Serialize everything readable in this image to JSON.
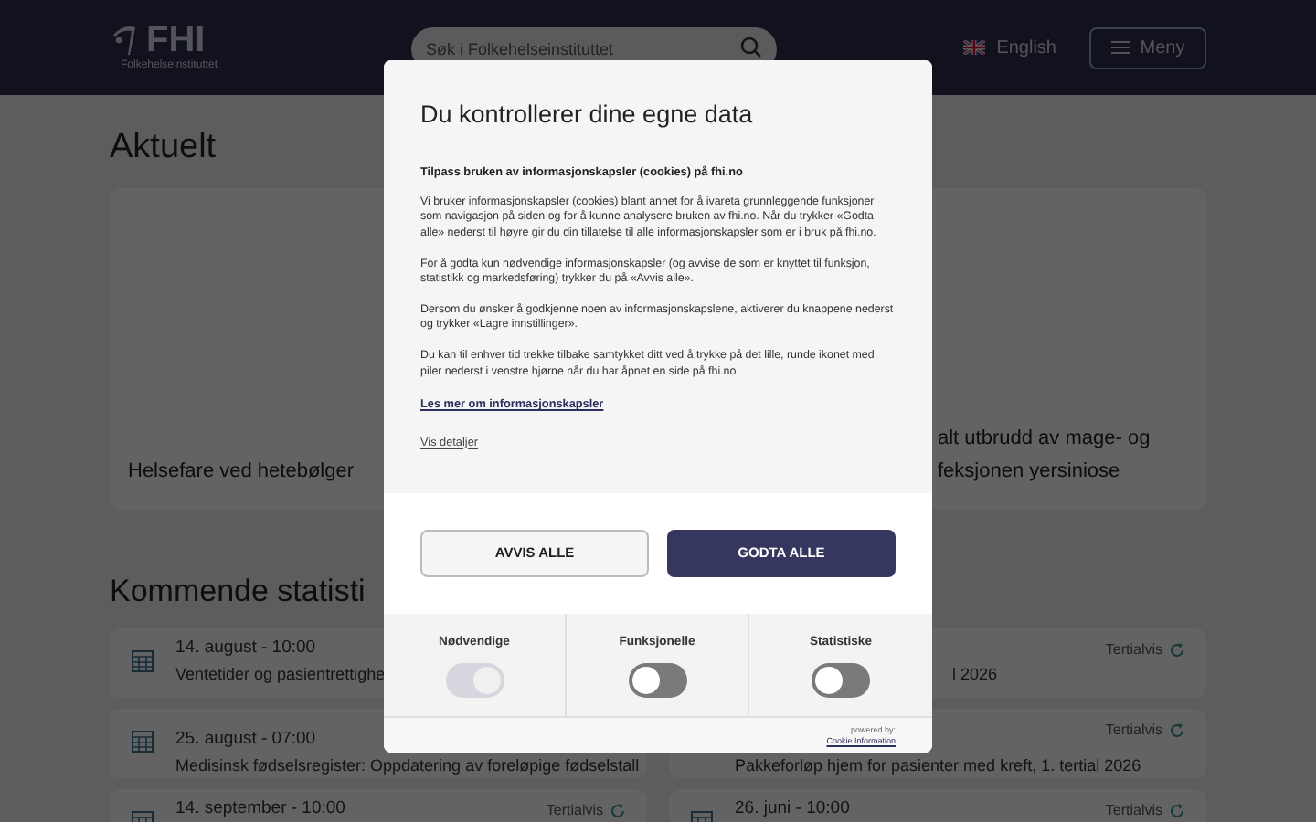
{
  "header": {
    "logo": "FHI",
    "logo_subtitle": "Folkehelseinstituttet",
    "search": {
      "placeholder": "Søk i Folkehelseinstituttet"
    },
    "language": "English",
    "menu": "Meny"
  },
  "news": {
    "heading": "Aktuelt",
    "cards": [
      {
        "title_lines": [
          "Helsefare ved hetebølger"
        ]
      },
      {
        "title_lines": [
          "alt utbrudd av mage- og",
          "feksjonen yersiniose"
        ]
      }
    ]
  },
  "statistics": {
    "heading": "Kommende statisti",
    "columns": [
      [
        {
          "date": "14. august - 10:00",
          "title": "Ventetider og pasientrettighe"
        },
        {
          "date": "25. august - 07:00",
          "title": "Medisinsk fødselsregister: Oppdatering av foreløpige fødselstall"
        },
        {
          "date": "14. september - 10:00",
          "frequency": "Tertialvis"
        }
      ],
      [
        {
          "title": "l 2026",
          "frequency": "Tertialvis"
        },
        {
          "title": "Pakkeforløp hjem for pasienter med kreft, 1. tertial 2026",
          "frequency": "Tertialvis"
        },
        {
          "date": "26. juni - 10:00",
          "frequency": "Tertialvis"
        }
      ]
    ]
  },
  "consent": {
    "title": "Du kontrollerer dine egne data",
    "subtitle": "Tilpass bruken av informasjonskapsler (cookies) på fhi.no",
    "paragraphs": [
      "Vi bruker informasjonskapsler (cookies) blant annet for å ivareta grunnleggende funksjoner som navigasjon på siden og for å kunne analysere bruken av fhi.no. Når du trykker «Godta alle» nederst til høyre gir du din tillatelse til alle informasjonskapsler som er i bruk på fhi.no.",
      "For å godta kun nødvendige informasjonskapsler (og avvise de som er knyttet til funksjon, statistikk og markedsføring) trykker du på «Avvis alle».",
      "Dersom du ønsker å godkjenne noen av informasjonskapslene, aktiverer du knappene nederst og trykker «Lagre innstillinger».",
      "Du kan til enhver tid trekke tilbake samtykket ditt ved å trykke på det lille, runde ikonet med piler nederst i venstre hjørne når du har åpnet en side på fhi.no."
    ],
    "read_more": "Les mer om informasjonskapsler",
    "details": "Vis detaljer",
    "buttons": [
      {
        "label": "AVVIS ALLE",
        "kind": "secondary"
      },
      {
        "label": "GODTA ALLE",
        "kind": "primary"
      }
    ],
    "toggles": [
      {
        "label": "Nødvendige",
        "on": true,
        "disabled": true
      },
      {
        "label": "Funksjonelle",
        "on": false,
        "disabled": false
      },
      {
        "label": "Statistiske",
        "on": false,
        "disabled": false
      }
    ],
    "powered_by": "powered by:",
    "provider": "Cookie Information"
  }
}
